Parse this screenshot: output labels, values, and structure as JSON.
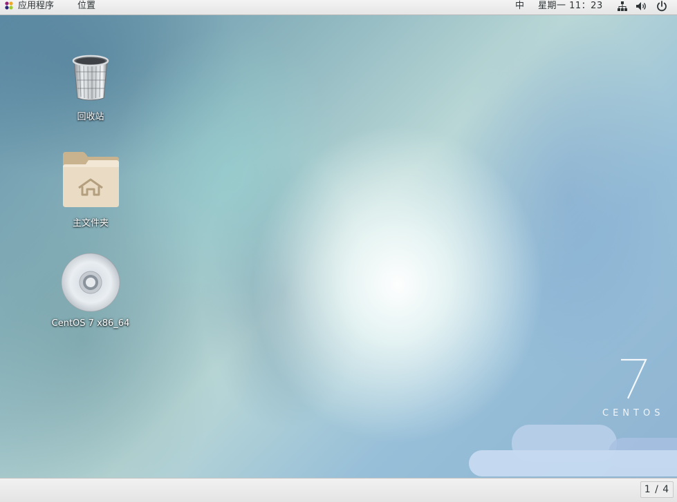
{
  "top_bar": {
    "applications_label": "应用程序",
    "places_label": "位置",
    "input_method": "中",
    "clock": "星期一 11：23",
    "network_icon": "network-icon",
    "volume_icon": "volume-icon",
    "power_icon": "power-icon"
  },
  "desktop": {
    "icons": [
      {
        "label": "回收站",
        "icon": "trash-icon"
      },
      {
        "label": "主文件夹",
        "icon": "home-folder-icon"
      },
      {
        "label": "CentOS 7 x86_64",
        "icon": "dvd-icon"
      }
    ],
    "watermark": {
      "number": "7",
      "word": "CENTOS"
    }
  },
  "bottom_bar": {
    "workspace_indicator": "1 / 4"
  }
}
